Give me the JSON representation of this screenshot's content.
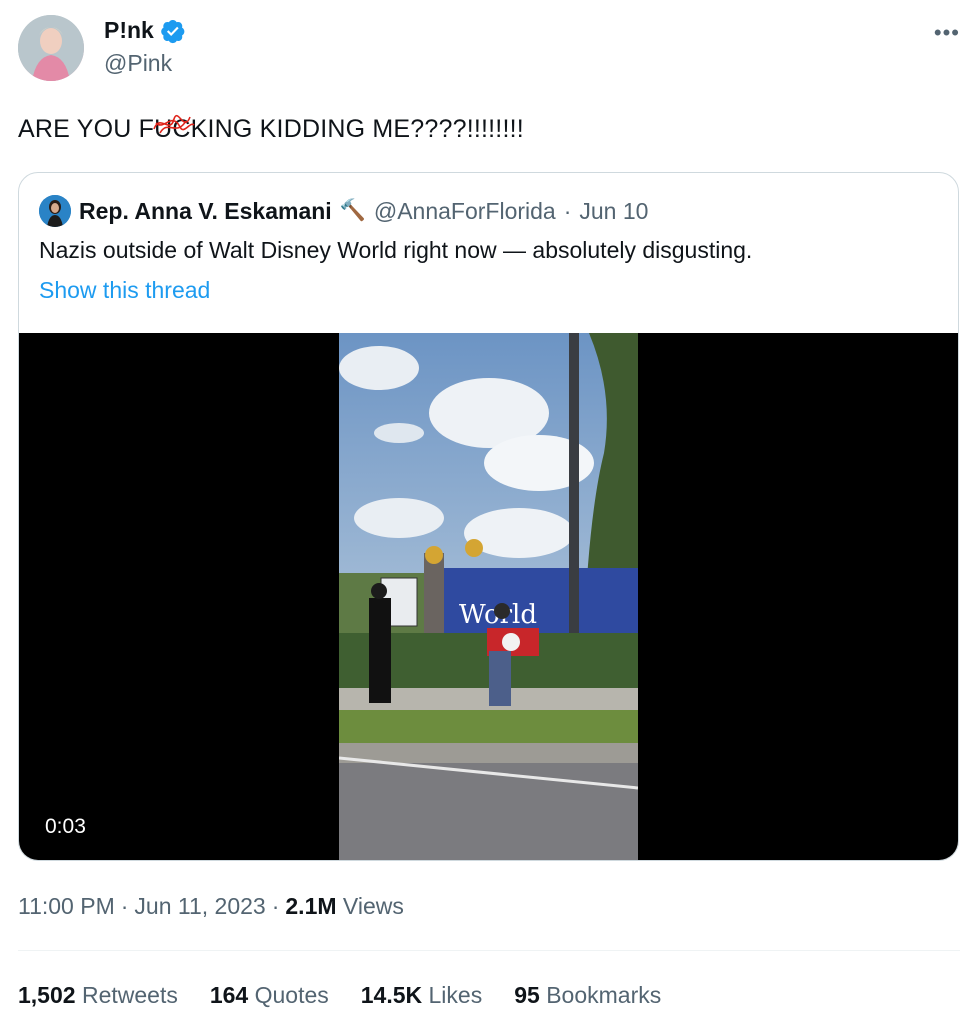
{
  "author": {
    "display_name": "P!nk",
    "handle": "@Pink"
  },
  "tweet": {
    "text_before": "ARE YOU F",
    "text_censored": "U",
    "text_after": "CKING KIDDING ME????!!!!!!!!"
  },
  "quote": {
    "display_name": "Rep. Anna V. Eskamani",
    "emoji": "🔨",
    "handle": "@AnnaForFlorida",
    "separator": "·",
    "date": "Jun 10",
    "text": "Nazis outside of Walt Disney World right now — absolutely disgusting.",
    "thread_link": "Show this thread",
    "video_time": "0:03"
  },
  "meta": {
    "time": "11:00 PM",
    "sep1": "·",
    "date": "Jun 11, 2023",
    "sep2": "·",
    "views_count": "2.1M",
    "views_label": "Views"
  },
  "stats": [
    {
      "num": "1,502",
      "label": "Retweets"
    },
    {
      "num": "164",
      "label": "Quotes"
    },
    {
      "num": "14.5K",
      "label": "Likes"
    },
    {
      "num": "95",
      "label": "Bookmarks"
    }
  ],
  "more_label": "•••",
  "colors": {
    "link": "#1d9bf0",
    "secondary": "#536471",
    "verified": "#1d9bf0"
  }
}
